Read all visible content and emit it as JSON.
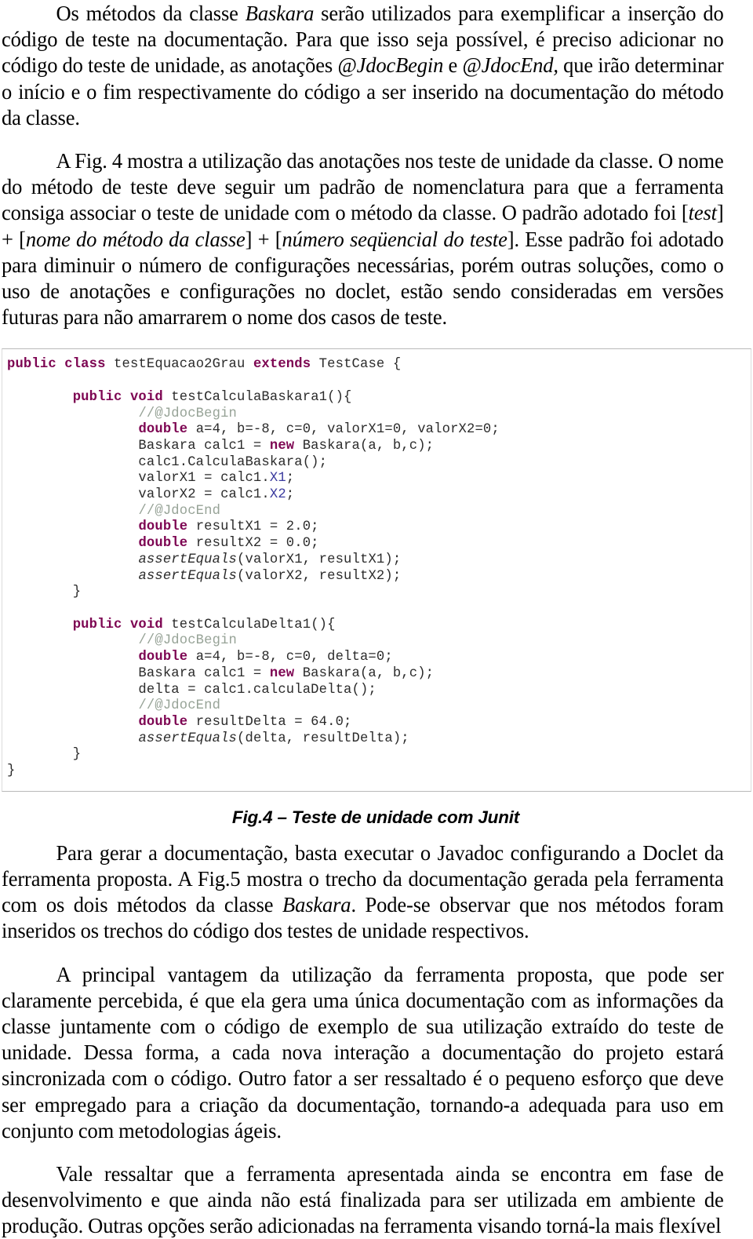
{
  "document": {
    "paragraphs": [
      {
        "id": "p-baskara-intro",
        "runs": [
          {
            "text": "Os métodos da classe ",
            "style": "normal"
          },
          {
            "text": "Baskara",
            "style": "italic"
          },
          {
            "text": " serão utilizados para exemplificar a inserção do código de teste na documentação. Para que isso seja possível, é preciso adicionar no código do teste de unidade, as anotações ",
            "style": "normal"
          },
          {
            "text": "@JdocBegin",
            "style": "italic"
          },
          {
            "text": " e ",
            "style": "normal"
          },
          {
            "text": "@JdocEnd,",
            "style": "italic"
          },
          {
            "text": " que irão determinar o início e o fim respectivamente do código a ser inserido na documentação do método da classe.",
            "style": "normal"
          }
        ]
      },
      {
        "id": "p-fig4-nomenclatura",
        "runs": [
          {
            "text": "A Fig. 4 mostra a utilização das anotações nos teste de unidade da classe. O nome do método de teste deve seguir um padrão de nomenclatura para que a ferramenta consiga associar o teste de unidade com o método da classe. O padrão adotado foi [",
            "style": "normal"
          },
          {
            "text": "test",
            "style": "italic"
          },
          {
            "text": "] + [",
            "style": "normal"
          },
          {
            "text": "nome do método da classe",
            "style": "italic"
          },
          {
            "text": "] + [",
            "style": "normal"
          },
          {
            "text": "número seqüencial do teste",
            "style": "italic"
          },
          {
            "text": "]. Esse padrão foi adotado para diminuir o número de configurações necessárias, porém outras soluções, como o uso de anotações e configurações no doclet, estão sendo consideradas em versões futuras para não amarrarem o nome dos casos de teste.",
            "style": "normal"
          }
        ]
      },
      {
        "id": "p-gerar-documentacao",
        "runs": [
          {
            "text": "Para gerar a documentação, basta executar o Javadoc configurando a Doclet da ferramenta proposta. A Fig.5 mostra o trecho da documentação gerada pela ferramenta com os dois métodos da classe ",
            "style": "normal"
          },
          {
            "text": "Baskara",
            "style": "italic"
          },
          {
            "text": ". Pode-se observar que nos métodos foram inseridos os trechos do código dos testes de unidade respectivos.",
            "style": "normal"
          }
        ]
      },
      {
        "id": "p-principal-vantagem",
        "runs": [
          {
            "text": "A principal vantagem da utilização da ferramenta proposta, que pode ser claramente percebida, é que ela gera uma única documentação com as informações da classe juntamente com o código de exemplo de sua utilização extraído do teste de unidade. Dessa forma, a cada nova interação a documentação do projeto estará sincronizada com o código. Outro fator a ser ressaltado é o pequeno esforço que deve ser empregado para a criação da documentação, tornando-a adequada para uso em conjunto com metodologias ágeis.",
            "style": "normal"
          }
        ]
      },
      {
        "id": "p-vale-ressaltar",
        "runs": [
          {
            "text": "Vale ressaltar que a ferramenta apresentada ainda se encontra em fase de desenvolvimento e que ainda não está finalizada para ser utilizada em ambiente de produção. Outras opções serão adicionadas na ferramenta visando torná-la mais flexível",
            "style": "normal"
          }
        ]
      }
    ],
    "figure": {
      "caption": "Fig.4 – Teste de unidade com Junit",
      "colors": {
        "keyword": "#7d0552",
        "comment": "#97a397",
        "field": "#3a3a9e",
        "plain": "#2b2b2b",
        "border": "#b9b9b9",
        "background": "#ffffff"
      },
      "code_lines": [
        [
          {
            "t": "public class ",
            "c": "kw"
          },
          {
            "t": "testEquacao2Grau ",
            "c": "pl"
          },
          {
            "t": "extends ",
            "c": "kw"
          },
          {
            "t": "TestCase {",
            "c": "pl"
          }
        ],
        [
          {
            "t": "",
            "c": "pl"
          }
        ],
        [
          {
            "t": "        ",
            "c": "pl"
          },
          {
            "t": "public void ",
            "c": "kw"
          },
          {
            "t": "testCalculaBaskara1(){",
            "c": "pl"
          }
        ],
        [
          {
            "t": "                ",
            "c": "pl"
          },
          {
            "t": "//@JdocBegin",
            "c": "cmt"
          }
        ],
        [
          {
            "t": "                ",
            "c": "pl"
          },
          {
            "t": "double ",
            "c": "kw"
          },
          {
            "t": "a=4, b=-8, c=0, valorX1=0, valorX2=0;",
            "c": "pl"
          }
        ],
        [
          {
            "t": "                Baskara calc1 = ",
            "c": "pl"
          },
          {
            "t": "new ",
            "c": "kw"
          },
          {
            "t": "Baskara(a, b,c);",
            "c": "pl"
          }
        ],
        [
          {
            "t": "                calc1.CalculaBaskara();",
            "c": "pl"
          }
        ],
        [
          {
            "t": "                valorX1 = calc1.",
            "c": "pl"
          },
          {
            "t": "X1",
            "c": "fld"
          },
          {
            "t": ";",
            "c": "pl"
          }
        ],
        [
          {
            "t": "                valorX2 = calc1.",
            "c": "pl"
          },
          {
            "t": "X2",
            "c": "fld"
          },
          {
            "t": ";",
            "c": "pl"
          }
        ],
        [
          {
            "t": "                ",
            "c": "pl"
          },
          {
            "t": "//@JdocEnd",
            "c": "cmt"
          }
        ],
        [
          {
            "t": "                ",
            "c": "pl"
          },
          {
            "t": "double ",
            "c": "kw"
          },
          {
            "t": "resultX1 = 2.0;",
            "c": "pl"
          }
        ],
        [
          {
            "t": "                ",
            "c": "pl"
          },
          {
            "t": "double ",
            "c": "kw"
          },
          {
            "t": "resultX2 = 0.0;",
            "c": "pl"
          }
        ],
        [
          {
            "t": "                ",
            "c": "pl"
          },
          {
            "t": "assertEquals",
            "c": "itm"
          },
          {
            "t": "(valorX1, resultX1);",
            "c": "pl"
          }
        ],
        [
          {
            "t": "                ",
            "c": "pl"
          },
          {
            "t": "assertEquals",
            "c": "itm"
          },
          {
            "t": "(valorX2, resultX2);",
            "c": "pl"
          }
        ],
        [
          {
            "t": "        }",
            "c": "pl"
          }
        ],
        [
          {
            "t": "",
            "c": "pl"
          }
        ],
        [
          {
            "t": "        ",
            "c": "pl"
          },
          {
            "t": "public void ",
            "c": "kw"
          },
          {
            "t": "testCalculaDelta1(){",
            "c": "pl"
          }
        ],
        [
          {
            "t": "                ",
            "c": "pl"
          },
          {
            "t": "//@JdocBegin",
            "c": "cmt"
          }
        ],
        [
          {
            "t": "                ",
            "c": "pl"
          },
          {
            "t": "double ",
            "c": "kw"
          },
          {
            "t": "a=4, b=-8, c=0, delta=0;",
            "c": "pl"
          }
        ],
        [
          {
            "t": "                Baskara calc1 = ",
            "c": "pl"
          },
          {
            "t": "new ",
            "c": "kw"
          },
          {
            "t": "Baskara(a, b,c);",
            "c": "pl"
          }
        ],
        [
          {
            "t": "                delta = calc1.calculaDelta();",
            "c": "pl"
          }
        ],
        [
          {
            "t": "                ",
            "c": "pl"
          },
          {
            "t": "//@JdocEnd",
            "c": "cmt"
          }
        ],
        [
          {
            "t": "                ",
            "c": "pl"
          },
          {
            "t": "double ",
            "c": "kw"
          },
          {
            "t": "resultDelta = 64.0;",
            "c": "pl"
          }
        ],
        [
          {
            "t": "                ",
            "c": "pl"
          },
          {
            "t": "assertEquals",
            "c": "itm"
          },
          {
            "t": "(delta, resultDelta);",
            "c": "pl"
          }
        ],
        [
          {
            "t": "        }",
            "c": "pl"
          }
        ],
        [
          {
            "t": "}",
            "c": "pl"
          }
        ]
      ]
    }
  }
}
